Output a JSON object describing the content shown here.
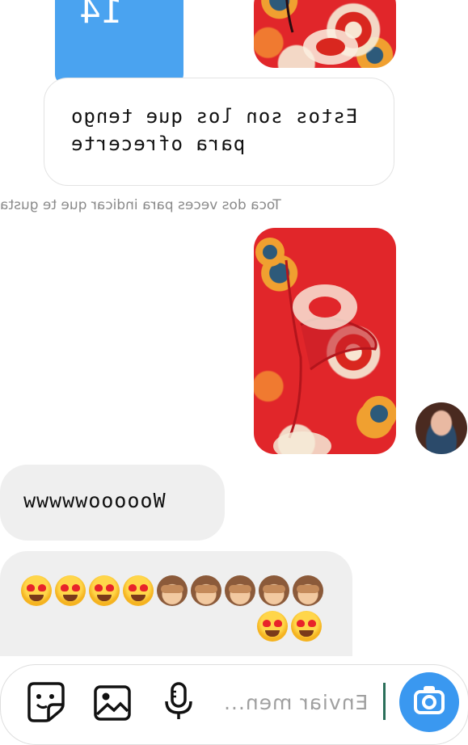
{
  "top_card": {
    "number": "14"
  },
  "message_out": {
    "text": "Estos son los que tengo para ofrecerte"
  },
  "hint": {
    "text": "Toca dos veces para indicar que te gusta"
  },
  "message_in_1": {
    "text": "Wooooowwwww"
  },
  "message_in_2": {
    "emojis_row1": [
      "see-no-evil-monkey",
      "see-no-evil-monkey",
      "see-no-evil-monkey",
      "see-no-evil-monkey",
      "see-no-evil-monkey",
      "heart-eyes",
      "heart-eyes",
      "heart-eyes",
      "heart-eyes"
    ],
    "emojis_row2": [
      "heart-eyes",
      "heart-eyes"
    ]
  },
  "composer": {
    "placeholder": "Enviar men...",
    "icons": [
      "camera-icon",
      "microphone-icon",
      "gallery-icon",
      "sticker-icon"
    ]
  },
  "colors": {
    "accent": "#3a98f0",
    "bubble_in": "#efefef",
    "photo": "#e1262a"
  }
}
